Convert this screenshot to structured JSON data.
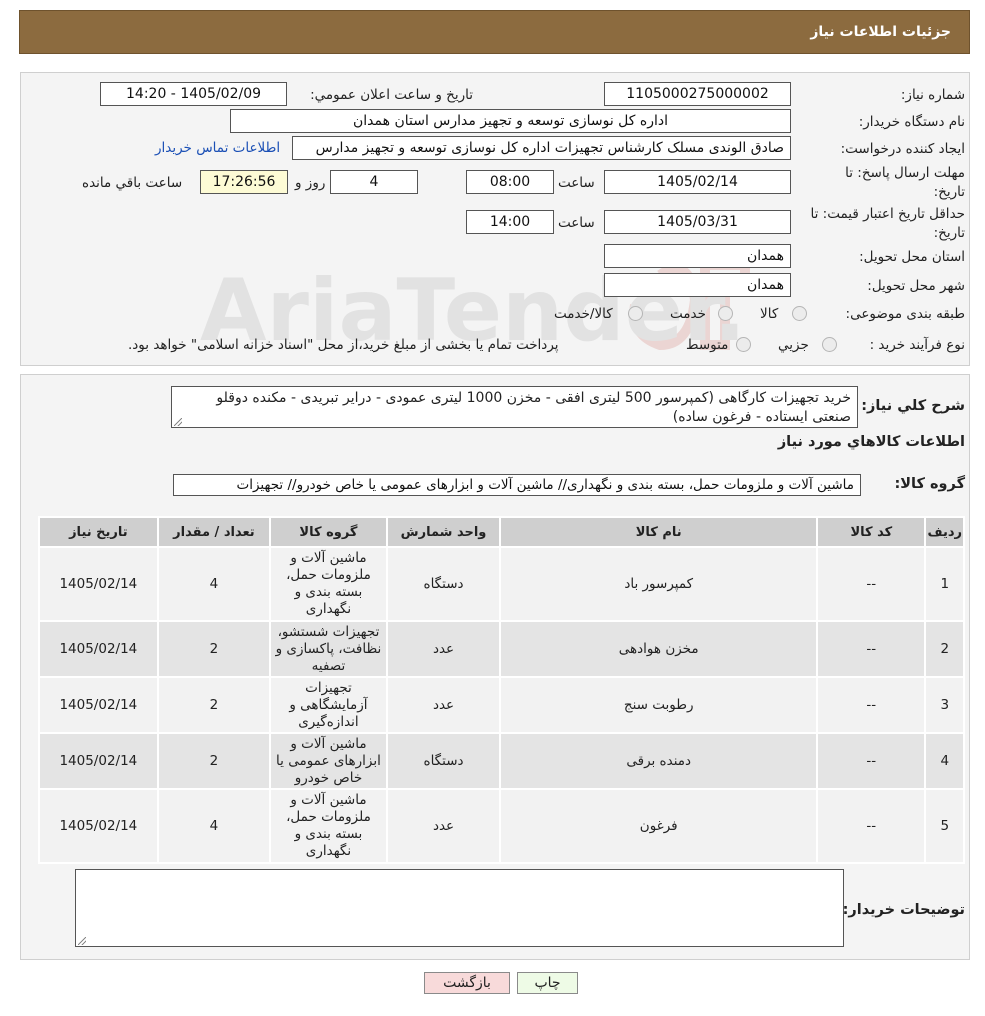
{
  "header": {
    "title": "جزئیات اطلاعات نیاز"
  },
  "info": {
    "need_number_label": "شماره نیاز:",
    "need_number": "1105000275000002",
    "announce_label": "تاريخ و ساعت اعلان عمومي:",
    "announce_value": "1405/02/09 - 14:20",
    "buyer_label": "نام دستگاه خريدار:",
    "buyer_value": "اداره کل نوسازی توسعه و تجهیز مدارس استان همدان",
    "creator_label": "ايجاد کننده درخواست:",
    "creator_value": "صادق الوندی مسلک کارشناس تجهیزات اداره کل نوسازی توسعه و تجهیز مدارس",
    "contact_link": "اطلاعات تماس خريدار",
    "deadline_label": "مهلت ارسال پاسخ: تا تاريخ:",
    "deadline_date": "1405/02/14",
    "time_label": "ساعت",
    "deadline_time": "08:00",
    "days_value": "4",
    "days_label": "روز و",
    "remaining_time": "17:26:56",
    "remaining_label": "ساعت باقي مانده",
    "validity_label": "حداقل تاريخ اعتبار قيمت: تا تاريخ:",
    "validity_date": "1405/03/31",
    "validity_time": "14:00",
    "province_label": "استان محل تحويل:",
    "province_value": "همدان",
    "city_label": "شهر محل تحويل:",
    "city_value": "همدان",
    "category_label": "طبقه بندی موضوعی:",
    "category_options": [
      "کالا",
      "خدمت",
      "کالا/خدمت"
    ],
    "process_label": "نوع فرآيند خريد :",
    "process_options": [
      "جزيي",
      "متوسط"
    ],
    "process_note": "پرداخت تمام یا بخشی از مبلغ خرید،از محل \"اسناد خزانه اسلامی\" خواهد بود."
  },
  "details": {
    "summary_label": "شرح کلي نياز:",
    "summary_value": "خرید تجهیزات کارگاهی (کمپرسور 500 لیتری افقی - مخزن 1000 لیتری عمودی - درایر تبریدی - مکنده دوقلو صنعتی ایستاده - فرغون ساده)",
    "goods_info_title": "اطلاعات کالاهاي مورد نياز",
    "group_label": "گروه کالا:",
    "group_value": "ماشین آلات و ملزومات حمل، بسته بندی و نگهداری//  ماشین آلات و ابزارهای عمومی یا خاص خودرو// تجهیزات",
    "columns": [
      "رديف",
      "کد کالا",
      "نام کالا",
      "واحد شمارش",
      "گروه کالا",
      "تعداد / مقدار",
      "تاريخ نياز"
    ],
    "rows": [
      {
        "row": "1",
        "code": "--",
        "name": "کمپرسور باد",
        "unit": "دستگاه",
        "group": "ماشین آلات و ملزومات حمل، بسته بندی و نگهداری",
        "qty": "4",
        "date": "1405/02/14"
      },
      {
        "row": "2",
        "code": "--",
        "name": "مخزن هوادهی",
        "unit": "عدد",
        "group": "تجهیزات شستشو، نظافت، پاکسازی و تصفیه",
        "qty": "2",
        "date": "1405/02/14"
      },
      {
        "row": "3",
        "code": "--",
        "name": "رطوبت سنج",
        "unit": "عدد",
        "group": "تجهیزات آزمایشگاهی و اندازه‌گیری",
        "qty": "2",
        "date": "1405/02/14"
      },
      {
        "row": "4",
        "code": "--",
        "name": "دمنده برقی",
        "unit": "دستگاه",
        "group": "ماشین آلات و ابزارهای عمومی یا خاص خودرو",
        "qty": "2",
        "date": "1405/02/14"
      },
      {
        "row": "5",
        "code": "--",
        "name": "فرغون",
        "unit": "عدد",
        "group": "ماشین آلات و ملزومات حمل، بسته بندی و نگهداری",
        "qty": "4",
        "date": "1405/02/14"
      }
    ],
    "buyer_notes_label": "توضيحات خريدار:",
    "buyer_notes_value": ""
  },
  "buttons": {
    "print": "چاپ",
    "back": "بازگشت"
  },
  "watermark": {
    "text": "AriaTender.neT"
  },
  "colors": {
    "header": "#8c6b3f",
    "back_button": "#f8dada",
    "print_button": "#eefbe6",
    "link": "#1a4fb5"
  }
}
